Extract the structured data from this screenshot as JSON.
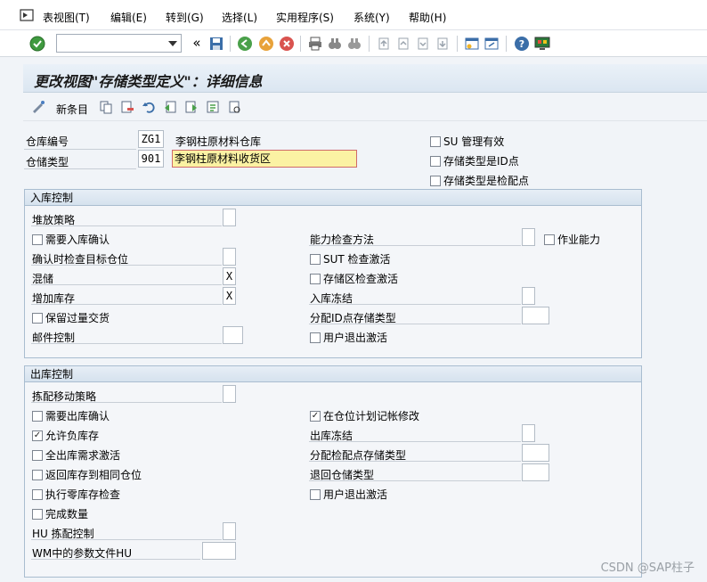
{
  "menu": [
    "表视图(T)",
    "编辑(E)",
    "转到(G)",
    "选择(L)",
    "实用程序(S)",
    "系统(Y)",
    "帮助(H)"
  ],
  "toolbar": {
    "command_field_value": "",
    "back_double_label": "«"
  },
  "title": "更改视图\"存储类型定义\"：详细信息",
  "app_toolbar": {
    "new_entries_label": "新条目"
  },
  "header": {
    "warehouse_label": "仓库编号",
    "warehouse_value": "ZG1",
    "warehouse_desc": "李钢柱原材料仓库",
    "storage_type_label": "仓储类型",
    "storage_type_value": "901",
    "storage_type_desc": "李钢柱原材料收货区",
    "su_mgmt": {
      "label": "SU 管理有效",
      "checked": false
    },
    "is_id_point": {
      "label": "存储类型是ID点",
      "checked": false
    },
    "is_pick_point": {
      "label": "存储类型是检配点",
      "checked": false
    }
  },
  "inbound": {
    "title": "入库控制",
    "putaway_strategy_label": "堆放策略",
    "putaway_strategy_value": "",
    "require_confirm": {
      "label": "需要入库确认",
      "checked": false
    },
    "capacity_check_label": "能力检查方法",
    "capacity_check_value": "",
    "work_capacity": {
      "label": "作业能力",
      "checked": false
    },
    "confirm_check_dest_label": "确认时检查目标仓位",
    "confirm_check_dest_value": "",
    "sut_check": {
      "label": "SUT 检查激活",
      "checked": false
    },
    "mixed_label": "混储",
    "mixed_value": "X",
    "storage_section_check": {
      "label": "存储区检查激活",
      "checked": false
    },
    "add_stock_label": "增加库存",
    "add_stock_value": "X",
    "inbound_freeze_label": "入库冻结",
    "inbound_freeze_value": "",
    "keep_overdelivery": {
      "label": "保留过量交货",
      "checked": false
    },
    "assign_id_type_label": "分配ID点存储类型",
    "assign_id_type_value": "",
    "mail_control_label": "邮件控制",
    "mail_control_value": "",
    "user_exit": {
      "label": "用户退出激活",
      "checked": false
    }
  },
  "outbound": {
    "title": "出库控制",
    "picking_strategy_label": "拣配移动策略",
    "picking_strategy_value": "",
    "require_confirm": {
      "label": "需要出库确认",
      "checked": false
    },
    "bin_planned_change": {
      "label": "在仓位计划记帐修改",
      "checked": true
    },
    "allow_negative": {
      "label": "允许负库存",
      "checked": true
    },
    "outbound_freeze_label": "出库冻结",
    "outbound_freeze_value": "",
    "full_stock_required": {
      "label": "全出库需求激活",
      "checked": false
    },
    "assign_pick_type_label": "分配检配点存储类型",
    "assign_pick_type_value": "",
    "return_same_bin": {
      "label": "返回库存到相同仓位",
      "checked": false
    },
    "return_storage_type_label": "退回仓储类型",
    "return_storage_type_value": "",
    "zero_stock_check": {
      "label": "执行零库存检查",
      "checked": false
    },
    "user_exit": {
      "label": "用户退出激活",
      "checked": false
    },
    "complete_qty": {
      "label": "完成数量",
      "checked": false
    },
    "hu_picking_label": "HU 拣配控制",
    "hu_picking_value": "",
    "wm_param_profile_label": "WM中的参数文件HU",
    "wm_param_profile_value": ""
  },
  "watermark": "CSDN @SAP柱子"
}
